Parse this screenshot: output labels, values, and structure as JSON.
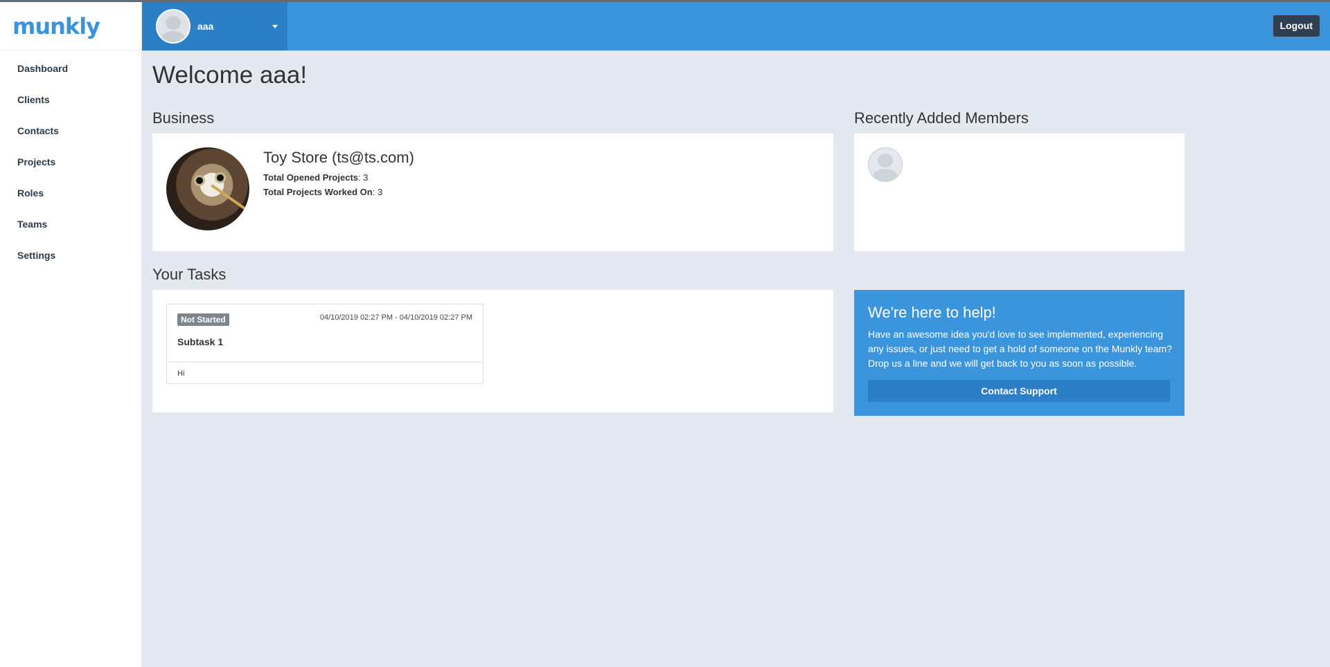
{
  "brand": {
    "logo_text": "munkly"
  },
  "sidebar": {
    "items": [
      {
        "label": "Dashboard"
      },
      {
        "label": "Clients"
      },
      {
        "label": "Contacts"
      },
      {
        "label": "Projects"
      },
      {
        "label": "Roles"
      },
      {
        "label": "Teams"
      },
      {
        "label": "Settings"
      }
    ]
  },
  "header": {
    "user_name": "aaa",
    "logout_label": "Logout"
  },
  "main": {
    "welcome": "Welcome aaa!",
    "business": {
      "section_title": "Business",
      "name": "Toy Store (ts@ts.com)",
      "stats": [
        {
          "label": "Total Opened Projects",
          "value": ": 3"
        },
        {
          "label": "Total Projects Worked On",
          "value": ": 3"
        }
      ]
    },
    "members": {
      "section_title": "Recently Added Members"
    },
    "tasks": {
      "section_title": "Your Tasks",
      "items": [
        {
          "status": "Not Started",
          "date_range": "04/10/2019 02:27 PM - 04/10/2019 02:27 PM",
          "title": "Subtask 1",
          "description": "Hi"
        }
      ]
    },
    "help": {
      "title": "We're here to help!",
      "text": "Have an awesome idea you'd love to see implemented, experiencing any issues, or just need to get a hold of someone on the Munkly team? Drop us a line and we will get back to you as soon as possible.",
      "button_label": "Contact Support"
    }
  },
  "colors": {
    "primary": "#3b95dd",
    "primary_dark": "#2a7fc7",
    "main_bg": "#e3e8f1",
    "logout_bg": "#2e3f52",
    "badge_bg": "#7d858d"
  }
}
